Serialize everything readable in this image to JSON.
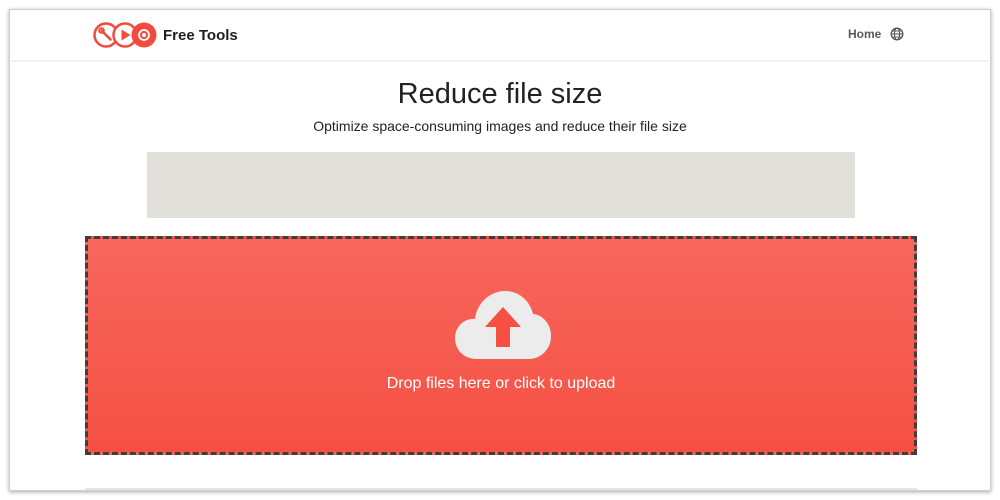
{
  "header": {
    "brand_name": "Free Tools",
    "nav_home_label": "Home",
    "language_icon": "globe-icon",
    "logo_icons": [
      "wrench-icon",
      "play-icon",
      "record-icon"
    ]
  },
  "main": {
    "title": "Reduce file size",
    "subtitle": "Optimize space-consuming images and reduce their file size"
  },
  "upload": {
    "label": "Drop files here or click to upload",
    "icon": "cloud-upload-icon"
  },
  "colors": {
    "brand_red": "#f24a3d",
    "dropzone_top": "#f7675d",
    "dropzone_bottom": "#f65043",
    "ad_placeholder": "#e2e0da"
  }
}
